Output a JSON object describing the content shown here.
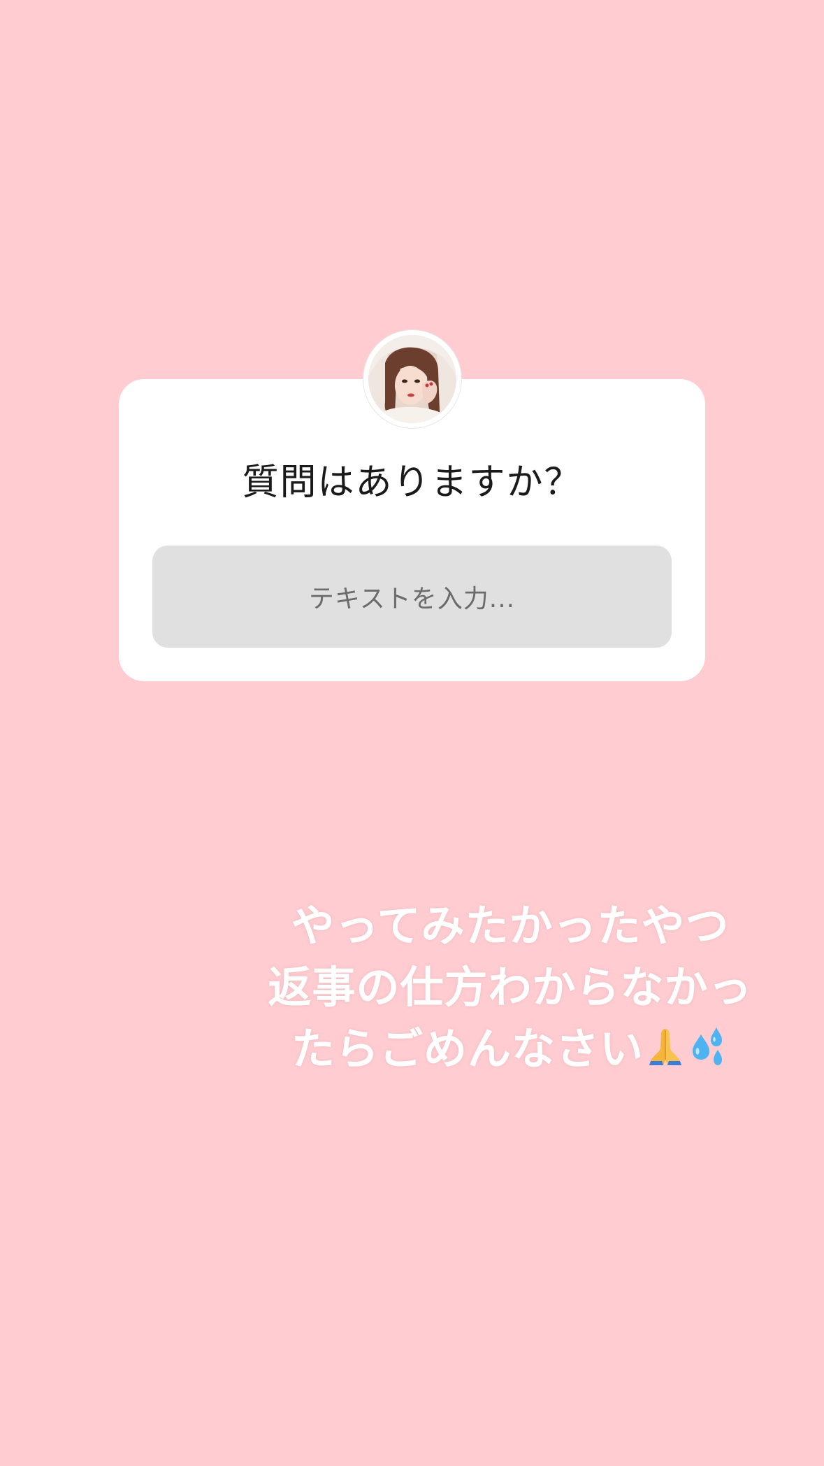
{
  "question_sticker": {
    "prompt": "質問はありますか？",
    "input_placeholder": "テキストを入力..."
  },
  "caption": {
    "line1": "やってみたかったやつ",
    "line2": "返事の仕方わからなかっ",
    "line3": "たらごめんなさい"
  },
  "icons": {
    "emoji1": "folded-hands-icon",
    "emoji2": "sweat-droplets-icon"
  },
  "colors": {
    "background": "#FFCDD1",
    "card": "#FFFFFF",
    "input": "#E0E0E0"
  }
}
